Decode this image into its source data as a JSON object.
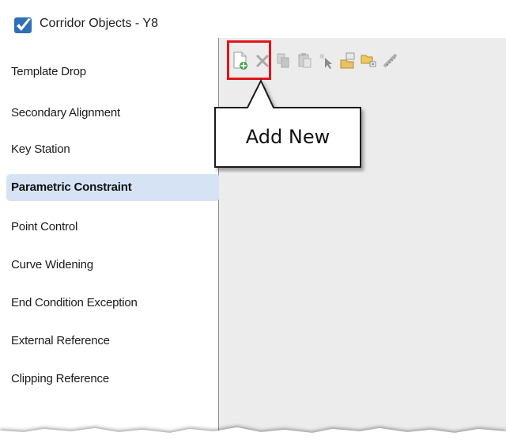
{
  "window": {
    "title": "Corridor Objects - Y8"
  },
  "sidebar": {
    "items": [
      {
        "label": "Template Drop",
        "active": false
      },
      {
        "label": "Secondary Alignment",
        "active": false
      },
      {
        "label": "Key Station",
        "active": false
      },
      {
        "label": "Parametric Constraint",
        "active": true
      },
      {
        "label": "Point Control",
        "active": false
      },
      {
        "label": "Curve Widening",
        "active": false
      },
      {
        "label": "End Condition Exception",
        "active": false
      },
      {
        "label": "External Reference",
        "active": false
      },
      {
        "label": "Clipping Reference",
        "active": false
      }
    ]
  },
  "toolbar": {
    "buttons": [
      {
        "icon": "add-new-icon",
        "enabled": true
      },
      {
        "icon": "delete-icon",
        "enabled": false
      },
      {
        "icon": "copy-icon",
        "enabled": false
      },
      {
        "icon": "paste-icon",
        "enabled": false
      },
      {
        "icon": "select-icon",
        "enabled": false
      },
      {
        "icon": "import-icon",
        "enabled": false
      },
      {
        "icon": "folder-icon",
        "enabled": false
      },
      {
        "icon": "measure-icon",
        "enabled": false
      }
    ]
  },
  "callout": {
    "label": "Add New"
  },
  "colors": {
    "highlight_border": "#e3141b",
    "active_item_bg": "#d5e3f4",
    "content_bg": "#ececec"
  }
}
